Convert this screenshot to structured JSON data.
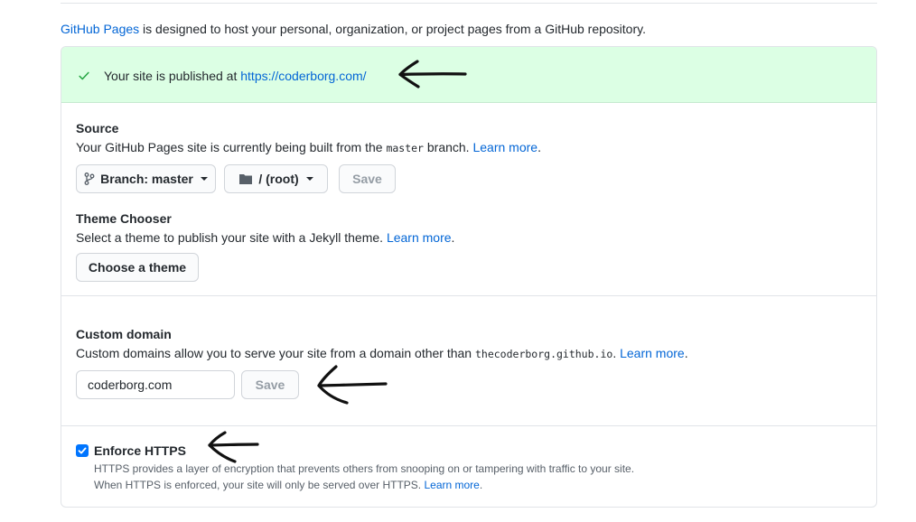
{
  "intro": {
    "link": "GitHub Pages",
    "text": " is designed to host your personal, organization, or project pages from a GitHub repository."
  },
  "banner": {
    "text": "Your site is published at ",
    "url": "https://coderborg.com/"
  },
  "source": {
    "title": "Source",
    "desc_before": "Your GitHub Pages site is currently being built from the ",
    "branch_code": "master",
    "desc_after": " branch. ",
    "learn_more": "Learn more",
    "period": ".",
    "branch_button": "Branch: master",
    "folder_button": "/ (root)",
    "save_button": "Save"
  },
  "theme": {
    "title": "Theme Chooser",
    "desc": "Select a theme to publish your site with a Jekyll theme. ",
    "learn_more": "Learn more",
    "period": ".",
    "button": "Choose a theme"
  },
  "custom_domain": {
    "title": "Custom domain",
    "desc_before": "Custom domains allow you to serve your site from a domain other than ",
    "domain_code": "thecoderborg.github.io",
    "desc_after": ". ",
    "learn_more": "Learn more",
    "period": ".",
    "input_value": "coderborg.com",
    "save_button": "Save"
  },
  "https": {
    "label": "Enforce HTTPS",
    "checked": true,
    "line1": "HTTPS provides a layer of encryption that prevents others from snooping on or tampering with traffic to your site.",
    "line2": "When HTTPS is enforced, your site will only be served over HTTPS. ",
    "learn_more": "Learn more",
    "period": "."
  },
  "colors": {
    "link": "#0366d6",
    "banner_bg": "#dcffe4",
    "checkbox": "#0075ff"
  }
}
